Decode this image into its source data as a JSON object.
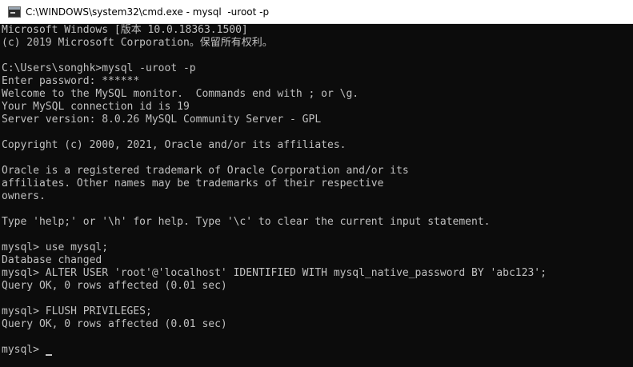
{
  "window": {
    "title": "C:\\WINDOWS\\system32\\cmd.exe - mysql  -uroot -p",
    "icon": "console-icon"
  },
  "console": {
    "lines": [
      "Microsoft Windows [版本 10.0.18363.1500]",
      "(c) 2019 Microsoft Corporation。保留所有权利。",
      "",
      "C:\\Users\\songhk>mysql -uroot -p",
      "Enter password: ******",
      "Welcome to the MySQL monitor.  Commands end with ; or \\g.",
      "Your MySQL connection id is 19",
      "Server version: 8.0.26 MySQL Community Server - GPL",
      "",
      "Copyright (c) 2000, 2021, Oracle and/or its affiliates.",
      "",
      "Oracle is a registered trademark of Oracle Corporation and/or its",
      "affiliates. Other names may be trademarks of their respective",
      "owners.",
      "",
      "Type 'help;' or '\\h' for help. Type '\\c' to clear the current input statement.",
      "",
      "mysql> use mysql;",
      "Database changed",
      "mysql> ALTER USER 'root'@'localhost' IDENTIFIED WITH mysql_native_password BY 'abc123';",
      "Query OK, 0 rows affected (0.01 sec)",
      "",
      "mysql> FLUSH PRIVILEGES;",
      "Query OK, 0 rows affected (0.01 sec)",
      "",
      "mysql> "
    ]
  },
  "colors": {
    "background": "#0c0c0c",
    "text": "#c0c0c0",
    "titlebar": "#ffffff"
  }
}
